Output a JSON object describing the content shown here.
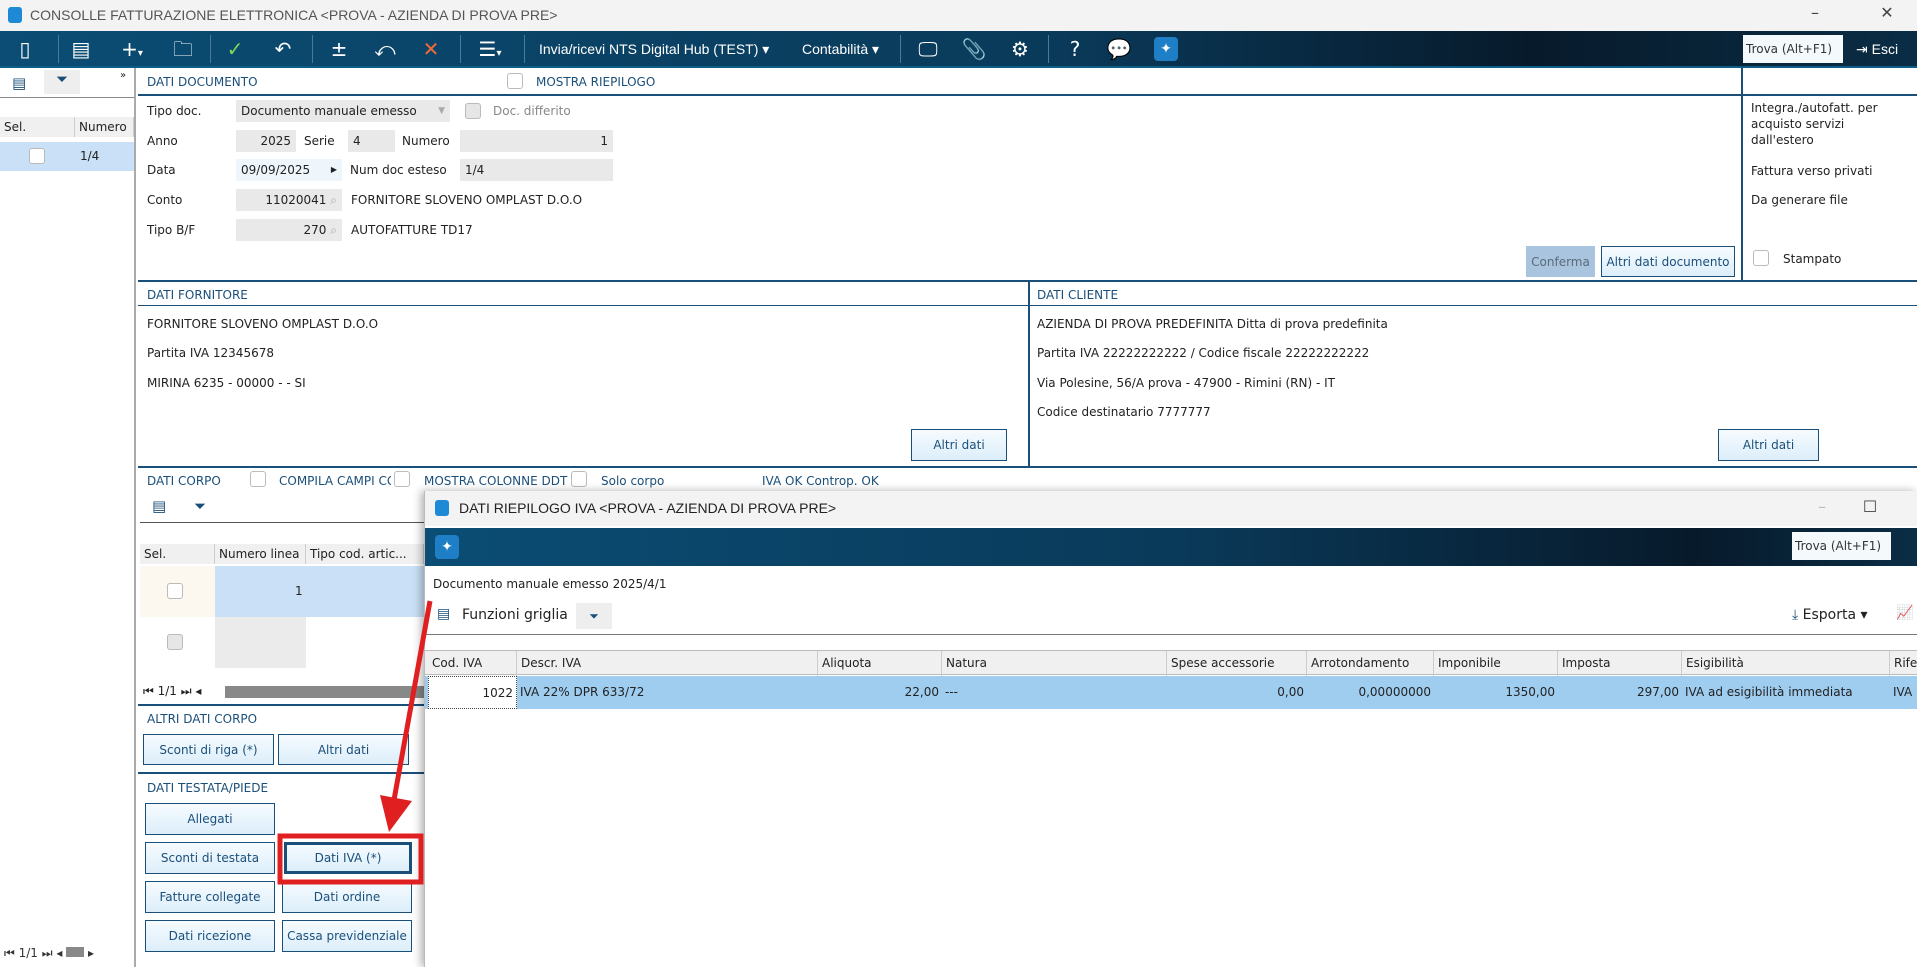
{
  "window": {
    "title": "CONSOLLE FATTURAZIONE ELETTRONICA <PROVA - AZIENDA DI PROVA PRE>"
  },
  "toolbar": {
    "menu_nts": "Invia/ricevi NTS Digital Hub (TEST) ▾",
    "menu_contabilita": "Contabilità ▾",
    "search_placeholder": "Trova (Alt+F1)",
    "exit": "Esci"
  },
  "left": {
    "col_sel": "Sel.",
    "col_numero": "Numero",
    "row_numero": "1/4",
    "pager": "1/1"
  },
  "doc": {
    "header": "DATI DOCUMENTO",
    "mostra_riepilogo": "MOSTRA RIEPILOGO",
    "tipo_doc_label": "Tipo doc.",
    "tipo_doc": "Documento manuale emesso",
    "doc_differito": "Doc. differito",
    "anno_label": "Anno",
    "anno": "2025",
    "serie_label": "Serie",
    "serie": "4",
    "numero_label": "Numero",
    "numero": "1",
    "data_label": "Data",
    "data": "09/09/2025",
    "num_esteso_label": "Num doc esteso",
    "num_esteso": "1/4",
    "conto_label": "Conto",
    "conto": "11020041",
    "conto_desc": "FORNITORE SLOVENO OMPLAST D.O.O",
    "tipobf_label": "Tipo B/F",
    "tipobf": "270",
    "tipobf_desc": "AUTOFATTURE TD17",
    "conferma": "Conferma",
    "altri_dati_doc": "Altri dati documento"
  },
  "side": {
    "integra": "Integra./autofatt. per acquisto servizi dall'estero",
    "privati": "Fattura verso privati",
    "genera": "Da generare file",
    "stampato": "Stampato"
  },
  "fornitore": {
    "header": "DATI FORNITORE",
    "name": "FORNITORE SLOVENO OMPLAST D.O.O",
    "piva": "Partita IVA 12345678",
    "addr": "MIRINA 6235 - 00000 -  - SI",
    "altri": "Altri dati"
  },
  "cliente": {
    "header": "DATI CLIENTE",
    "name": "AZIENDA DI PROVA PREDEFINITA Ditta di prova predefinita",
    "piva": "Partita IVA 22222222222 / Codice fiscale 22222222222",
    "addr": "Via Polesine, 56/A prova - 47900 - Rimini (RN)  - IT",
    "dest": "Codice destinatario 7777777",
    "altri": "Altri dati"
  },
  "corpo": {
    "header": "DATI CORPO",
    "compila": "COMPILA CAMPI CG",
    "mostra_ddt": "MOSTRA COLONNE DDT",
    "solo_corpo": "Solo corpo",
    "status": "IVA OK Controp. OK",
    "col_sel": "Sel.",
    "col_linea": "Numero linea",
    "col_tipo": "Tipo cod. artic...",
    "row1_linea": "1",
    "pager": "1/1"
  },
  "altri_corpo": {
    "header": "ALTRI DATI CORPO",
    "sconti_riga": "Sconti di riga (*)",
    "altri_dati": "Altri dati"
  },
  "testata": {
    "header": "DATI TESTATA/PIEDE",
    "allegati": "Allegati",
    "sconti_testata": "Sconti di testata",
    "dati_iva": "Dati IVA (*)",
    "fatture_collegate": "Fatture collegate",
    "dati_ordine": "Dati ordine",
    "dati_ricezione": "Dati ricezione",
    "cassa": "Cassa previdenziale"
  },
  "dialog": {
    "title": "DATI RIEPILOGO IVA <PROVA - AZIENDA DI PROVA PRE>",
    "search_placeholder": "Trova (Alt+F1)",
    "doc_info": "Documento manuale emesso 2025/4/1",
    "funzioni": "Funzioni griglia",
    "esporta": "Esporta ▾",
    "columns": [
      "Cod. IVA",
      "Descr. IVA",
      "Aliquota",
      "Natura",
      "Spese accessorie",
      "Arrotondamento",
      "Imponibile",
      "Imposta",
      "Esigibilità",
      "Rife"
    ],
    "row": [
      "1022",
      "IVA 22% DPR 633/72",
      "22,00",
      "---",
      "0,00",
      "0,00000000",
      "1350,00",
      "297,00",
      "IVA ad esigibilità immediata",
      "IVA"
    ]
  },
  "colors": {
    "accent": "#1a4f7a",
    "selection": "#9fcdf0",
    "annotation": "#e02020"
  }
}
